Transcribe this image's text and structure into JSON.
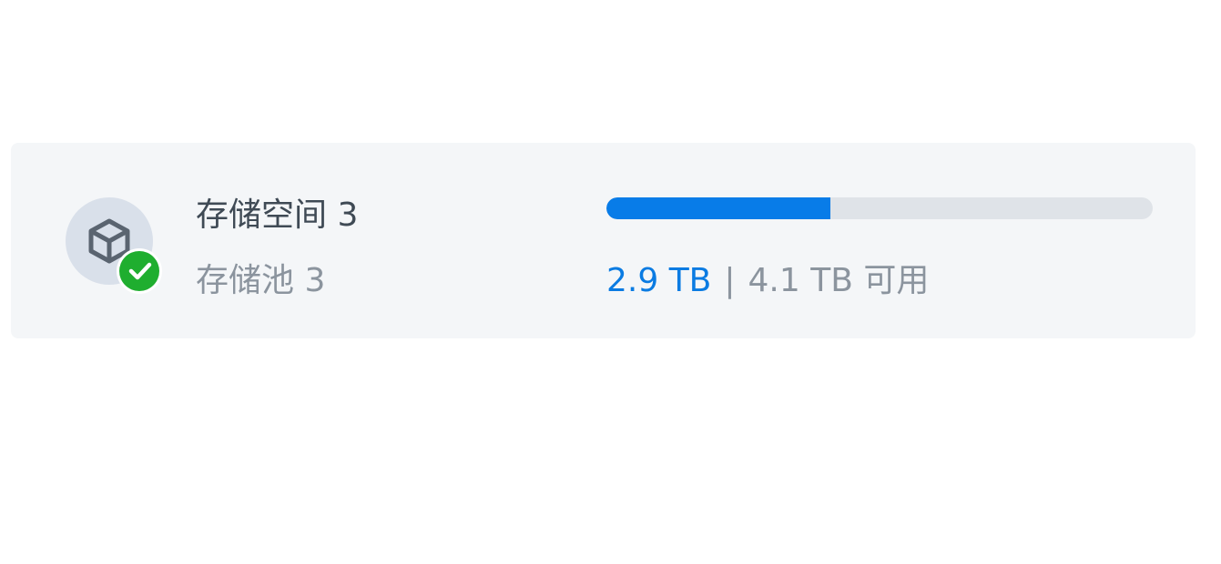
{
  "volume": {
    "title": "存储空间 3",
    "pool": "存储池 3",
    "status_icon": "check-circle-icon",
    "volume_icon": "cube-icon"
  },
  "usage": {
    "used": "2.9 TB",
    "separator": "|",
    "available": "4.1 TB 可用",
    "used_fraction": 0.41,
    "fill_color": "#087ce8",
    "track_color": "#dfe3e8"
  }
}
